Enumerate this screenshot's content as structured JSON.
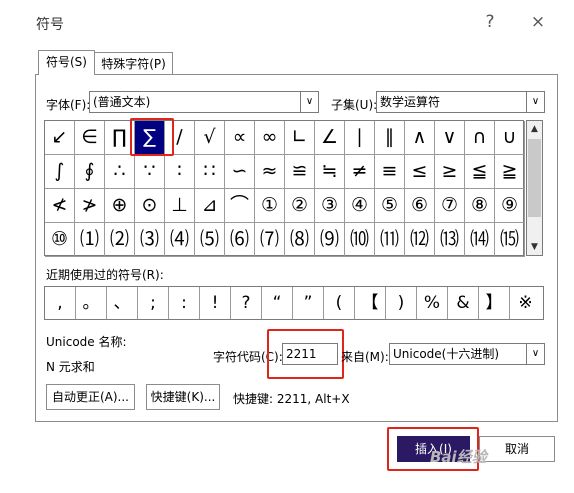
{
  "window": {
    "title": "符号",
    "help_glyph": "?",
    "close_glyph": "×"
  },
  "tabs": [
    {
      "label": "符号(S)"
    },
    {
      "label": "特殊字符(P)"
    }
  ],
  "font": {
    "label": "字体(F):",
    "value": "(普通文本)"
  },
  "subset": {
    "label": "子集(U):",
    "value": "数学运算符"
  },
  "symbol_rows": [
    [
      "↙",
      "∈",
      "∏",
      "∑",
      "∕",
      "√",
      "∝",
      "∞",
      "∟",
      "∠",
      "∣",
      "∥",
      "∧",
      "∨",
      "∩",
      "∪"
    ],
    [
      "∫",
      "∮",
      "∴",
      "∵",
      "∶",
      "∷",
      "∽",
      "≈",
      "≌",
      "≒",
      "≠",
      "≡",
      "≤",
      "≥",
      "≦",
      "≧"
    ],
    [
      "≮",
      "≯",
      "⊕",
      "⊙",
      "⊥",
      "⊿",
      "⌒",
      "①",
      "②",
      "③",
      "④",
      "⑤",
      "⑥",
      "⑦",
      "⑧",
      "⑨"
    ],
    [
      "⑩",
      "⑴",
      "⑵",
      "⑶",
      "⑷",
      "⑸",
      "⑹",
      "⑺",
      "⑻",
      "⑼",
      "⑽",
      "⑾",
      "⑿",
      "⒀",
      "⒁",
      "⒂"
    ]
  ],
  "selected_symbol": "∑",
  "recent": {
    "label": "近期使用过的符号(R):",
    "symbols": [
      ",",
      "。",
      "、",
      ";",
      ":",
      "!",
      "?",
      "“",
      "”",
      "(",
      "【",
      ")",
      "%",
      "&",
      "】",
      "※"
    ]
  },
  "unicode_name": {
    "label": "Unicode 名称:",
    "value": "N 元求和"
  },
  "char_code": {
    "label": "字符代码(C):",
    "value": "2211"
  },
  "from": {
    "label": "来自(M):",
    "value": "Unicode(十六进制)"
  },
  "buttons": {
    "autocorrect": "自动更正(A)...",
    "shortcut_key": "快捷键(K)...",
    "shortcut_text": "快捷键: 2211, Alt+X",
    "insert": "插入(I)",
    "cancel": "取消"
  },
  "watermark": "Bai经验",
  "colors": {
    "selected_cell": "#000080",
    "highlight_box": "#e0251b",
    "insert_button": "#2b1a63"
  },
  "icons": {
    "scroll_up": "▲",
    "scroll_down": "▼",
    "dropdown": "∨"
  }
}
